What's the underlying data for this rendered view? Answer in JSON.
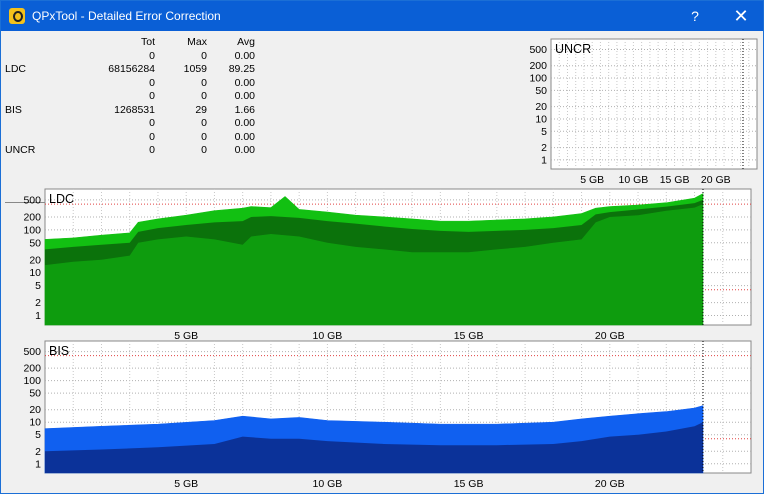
{
  "window": {
    "title": "QPxTool - Detailed Error Correction",
    "help_label": "?",
    "close_label": "✕"
  },
  "stats": {
    "headers": {
      "tot": "Tot",
      "max": "Max",
      "avg": "Avg"
    },
    "rows": [
      {
        "label": "",
        "tot": "0",
        "max": "0",
        "avg": "0.00"
      },
      {
        "label": "LDC",
        "tot": "68156284",
        "max": "1059",
        "avg": "89.25"
      },
      {
        "label": "",
        "tot": "0",
        "max": "0",
        "avg": "0.00"
      },
      {
        "label": "",
        "tot": "0",
        "max": "0",
        "avg": "0.00"
      },
      {
        "label": "BIS",
        "tot": "1268531",
        "max": "29",
        "avg": "1.66"
      },
      {
        "label": "",
        "tot": "0",
        "max": "0",
        "avg": "0.00"
      },
      {
        "label": "",
        "tot": "0",
        "max": "0",
        "avg": "0.00"
      },
      {
        "label": "UNCR",
        "tot": "0",
        "max": "0",
        "avg": "0.00"
      }
    ]
  },
  "chart_data": [
    {
      "type": "area",
      "title": "UNCR",
      "y_scale": "log",
      "y_ticks": [
        1,
        2,
        5,
        10,
        20,
        50,
        100,
        200,
        500
      ],
      "x_ticks": [
        "5 GB",
        "10 GB",
        "15 GB",
        "20 GB"
      ],
      "x_unit": "GB",
      "xlim": [
        0,
        25
      ],
      "x_end": 23.3,
      "series": [
        {
          "x": [
            0,
            23.3
          ],
          "values": [
            0,
            0
          ]
        }
      ],
      "colors": {
        "max": "#14a014",
        "avg": "#0a640a"
      }
    },
    {
      "type": "area",
      "title": "LDC",
      "y_scale": "log",
      "y_ticks": [
        1,
        2,
        5,
        10,
        20,
        50,
        100,
        200,
        500
      ],
      "x_ticks": [
        "5 GB",
        "10 GB",
        "15 GB",
        "20 GB"
      ],
      "x_unit": "GB",
      "xlim": [
        0,
        25
      ],
      "x_end": 23.3,
      "red_lines": [
        4,
        400
      ],
      "colors": {
        "max": "#12c012",
        "avg": "#0a640a"
      },
      "series": [
        {
          "name": "max",
          "x": [
            0,
            1,
            2,
            3,
            3.3,
            4,
            5,
            6,
            7,
            7.3,
            8,
            8.5,
            9,
            10,
            11,
            12,
            13,
            14,
            15,
            16,
            17,
            18,
            19,
            19.5,
            20,
            21,
            22,
            23,
            23.3
          ],
          "values": [
            60,
            65,
            75,
            85,
            150,
            180,
            220,
            280,
            320,
            350,
            330,
            600,
            300,
            260,
            220,
            200,
            180,
            160,
            160,
            170,
            180,
            200,
            240,
            320,
            350,
            380,
            430,
            550,
            700
          ]
        },
        {
          "name": "min",
          "x": [
            0,
            1,
            2,
            3,
            3.3,
            4,
            5,
            6,
            7,
            7.3,
            8,
            9,
            10,
            11,
            12,
            13,
            14,
            15,
            16,
            17,
            18,
            19,
            19.5,
            20,
            21,
            22,
            23,
            23.3
          ],
          "values": [
            15,
            18,
            20,
            25,
            50,
            60,
            70,
            60,
            45,
            70,
            80,
            70,
            50,
            40,
            35,
            30,
            30,
            30,
            35,
            40,
            50,
            60,
            150,
            200,
            220,
            280,
            330,
            400
          ]
        },
        {
          "name": "avg",
          "x": [
            0,
            1,
            2,
            3,
            3.3,
            4,
            5,
            6,
            7,
            7.3,
            8,
            9,
            10,
            11,
            12,
            13,
            14,
            15,
            16,
            17,
            18,
            19,
            19.5,
            20,
            21,
            22,
            23,
            23.3
          ],
          "values": [
            35,
            40,
            45,
            50,
            90,
            110,
            130,
            150,
            160,
            200,
            210,
            190,
            160,
            140,
            120,
            105,
            95,
            90,
            95,
            100,
            110,
            130,
            230,
            260,
            300,
            350,
            420,
            500
          ]
        }
      ]
    },
    {
      "type": "area",
      "title": "BIS",
      "y_scale": "log",
      "y_ticks": [
        1,
        2,
        5,
        10,
        20,
        50,
        100,
        200,
        500
      ],
      "x_ticks": [
        "5 GB",
        "10 GB",
        "15 GB",
        "20 GB"
      ],
      "x_unit": "GB",
      "xlim": [
        0,
        25
      ],
      "x_end": 23.3,
      "red_lines": [
        4,
        400
      ],
      "colors": {
        "max": "#1060f0",
        "avg": "#0a2a8a"
      },
      "series": [
        {
          "name": "max",
          "x": [
            0,
            2,
            4,
            6,
            7,
            8,
            9,
            10,
            12,
            14,
            16,
            18,
            19,
            20,
            21,
            22,
            23,
            23.3
          ],
          "values": [
            7,
            8,
            9,
            11,
            14,
            12,
            13,
            11,
            10,
            9,
            9,
            10,
            12,
            14,
            16,
            18,
            22,
            25
          ]
        },
        {
          "name": "avg",
          "x": [
            0,
            2,
            4,
            6,
            7,
            8,
            9,
            10,
            12,
            14,
            16,
            18,
            19,
            20,
            21,
            22,
            23,
            23.3
          ],
          "values": [
            2,
            2.2,
            2.5,
            3,
            4.5,
            4,
            4,
            3.5,
            3,
            2.8,
            2.8,
            3,
            3.5,
            4.5,
            5,
            6,
            8,
            10
          ]
        }
      ]
    }
  ]
}
